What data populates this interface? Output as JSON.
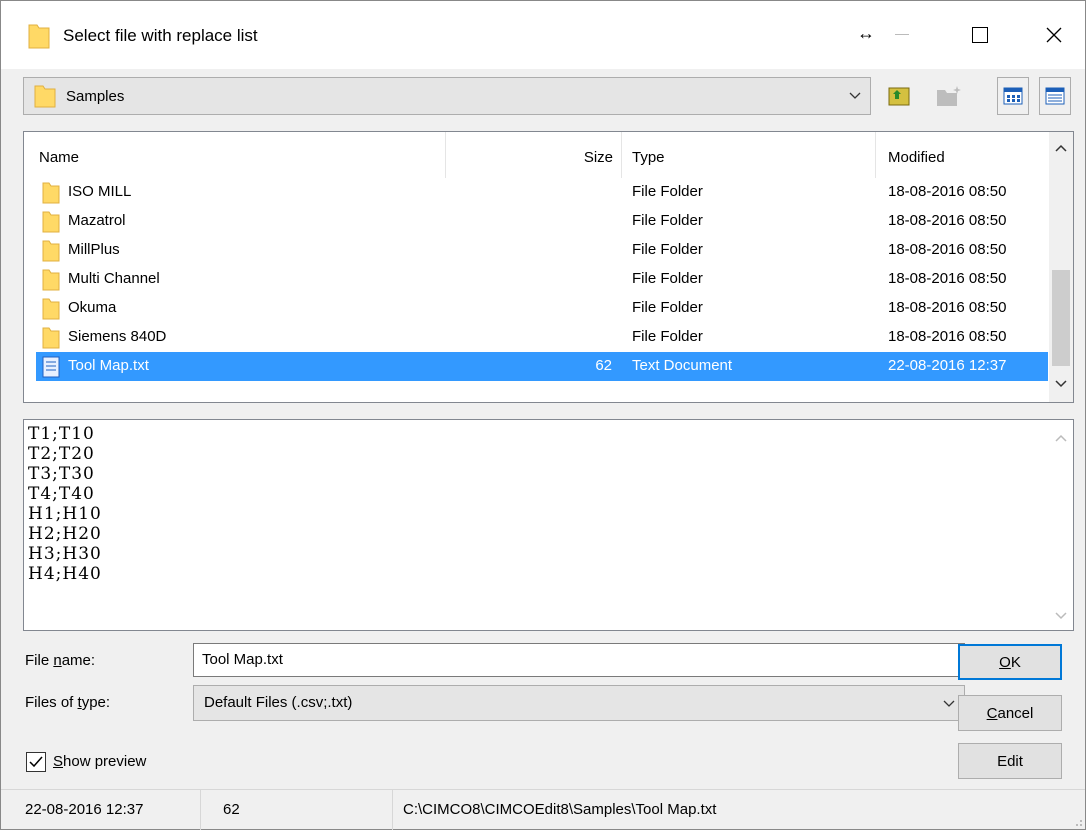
{
  "window": {
    "title": "Select file with replace list"
  },
  "title_controls": {
    "resize": "↔"
  },
  "folder_combo": {
    "value": "Samples"
  },
  "list": {
    "columns": {
      "name": "Name",
      "size": "Size",
      "type": "Type",
      "modified": "Modified"
    },
    "rows": [
      {
        "name": "ISO MILL",
        "size": "",
        "type": "File Folder",
        "modified": "18-08-2016 08:50"
      },
      {
        "name": "Mazatrol",
        "size": "",
        "type": "File Folder",
        "modified": "18-08-2016 08:50"
      },
      {
        "name": "MillPlus",
        "size": "",
        "type": "File Folder",
        "modified": "18-08-2016 08:50"
      },
      {
        "name": "Multi Channel",
        "size": "",
        "type": "File Folder",
        "modified": "18-08-2016 08:50"
      },
      {
        "name": "Okuma",
        "size": "",
        "type": "File Folder",
        "modified": "18-08-2016 08:50"
      },
      {
        "name": "Siemens 840D",
        "size": "",
        "type": "File Folder",
        "modified": "18-08-2016 08:50"
      },
      {
        "name": "Tool Map.txt",
        "size": "62",
        "type": "Text Document",
        "modified": "22-08-2016 12:37"
      }
    ]
  },
  "preview": {
    "text": "T1;T10\nT2;T20\nT3;T30\nT4;T40\nH1;H10\nH2;H20\nH3;H30\nH4;H40"
  },
  "form": {
    "file_name_label_pre": "File ",
    "file_name_label_u": "n",
    "file_name_label_post": "ame:",
    "file_name_value": "Tool Map.txt",
    "files_of_type_label_pre": "Files of ",
    "files_of_type_label_u": "t",
    "files_of_type_label_post": "ype:",
    "files_of_type_value": "Default Files (.csv;.txt)",
    "show_preview_u": "S",
    "show_preview_post": "how preview",
    "show_preview_checked": true
  },
  "buttons": {
    "ok_u": "O",
    "ok_post": "K",
    "cancel_u": "C",
    "cancel_post": "ancel",
    "edit": "Edit"
  },
  "status": {
    "modified": "22-08-2016 12:37",
    "size": "62",
    "path": "C:\\CIMCO8\\CIMCOEdit8\\Samples\\Tool Map.txt"
  },
  "colors": {
    "selection": "#3399ff",
    "default_button_border": "#0078d7",
    "folder": "#ffd966"
  }
}
